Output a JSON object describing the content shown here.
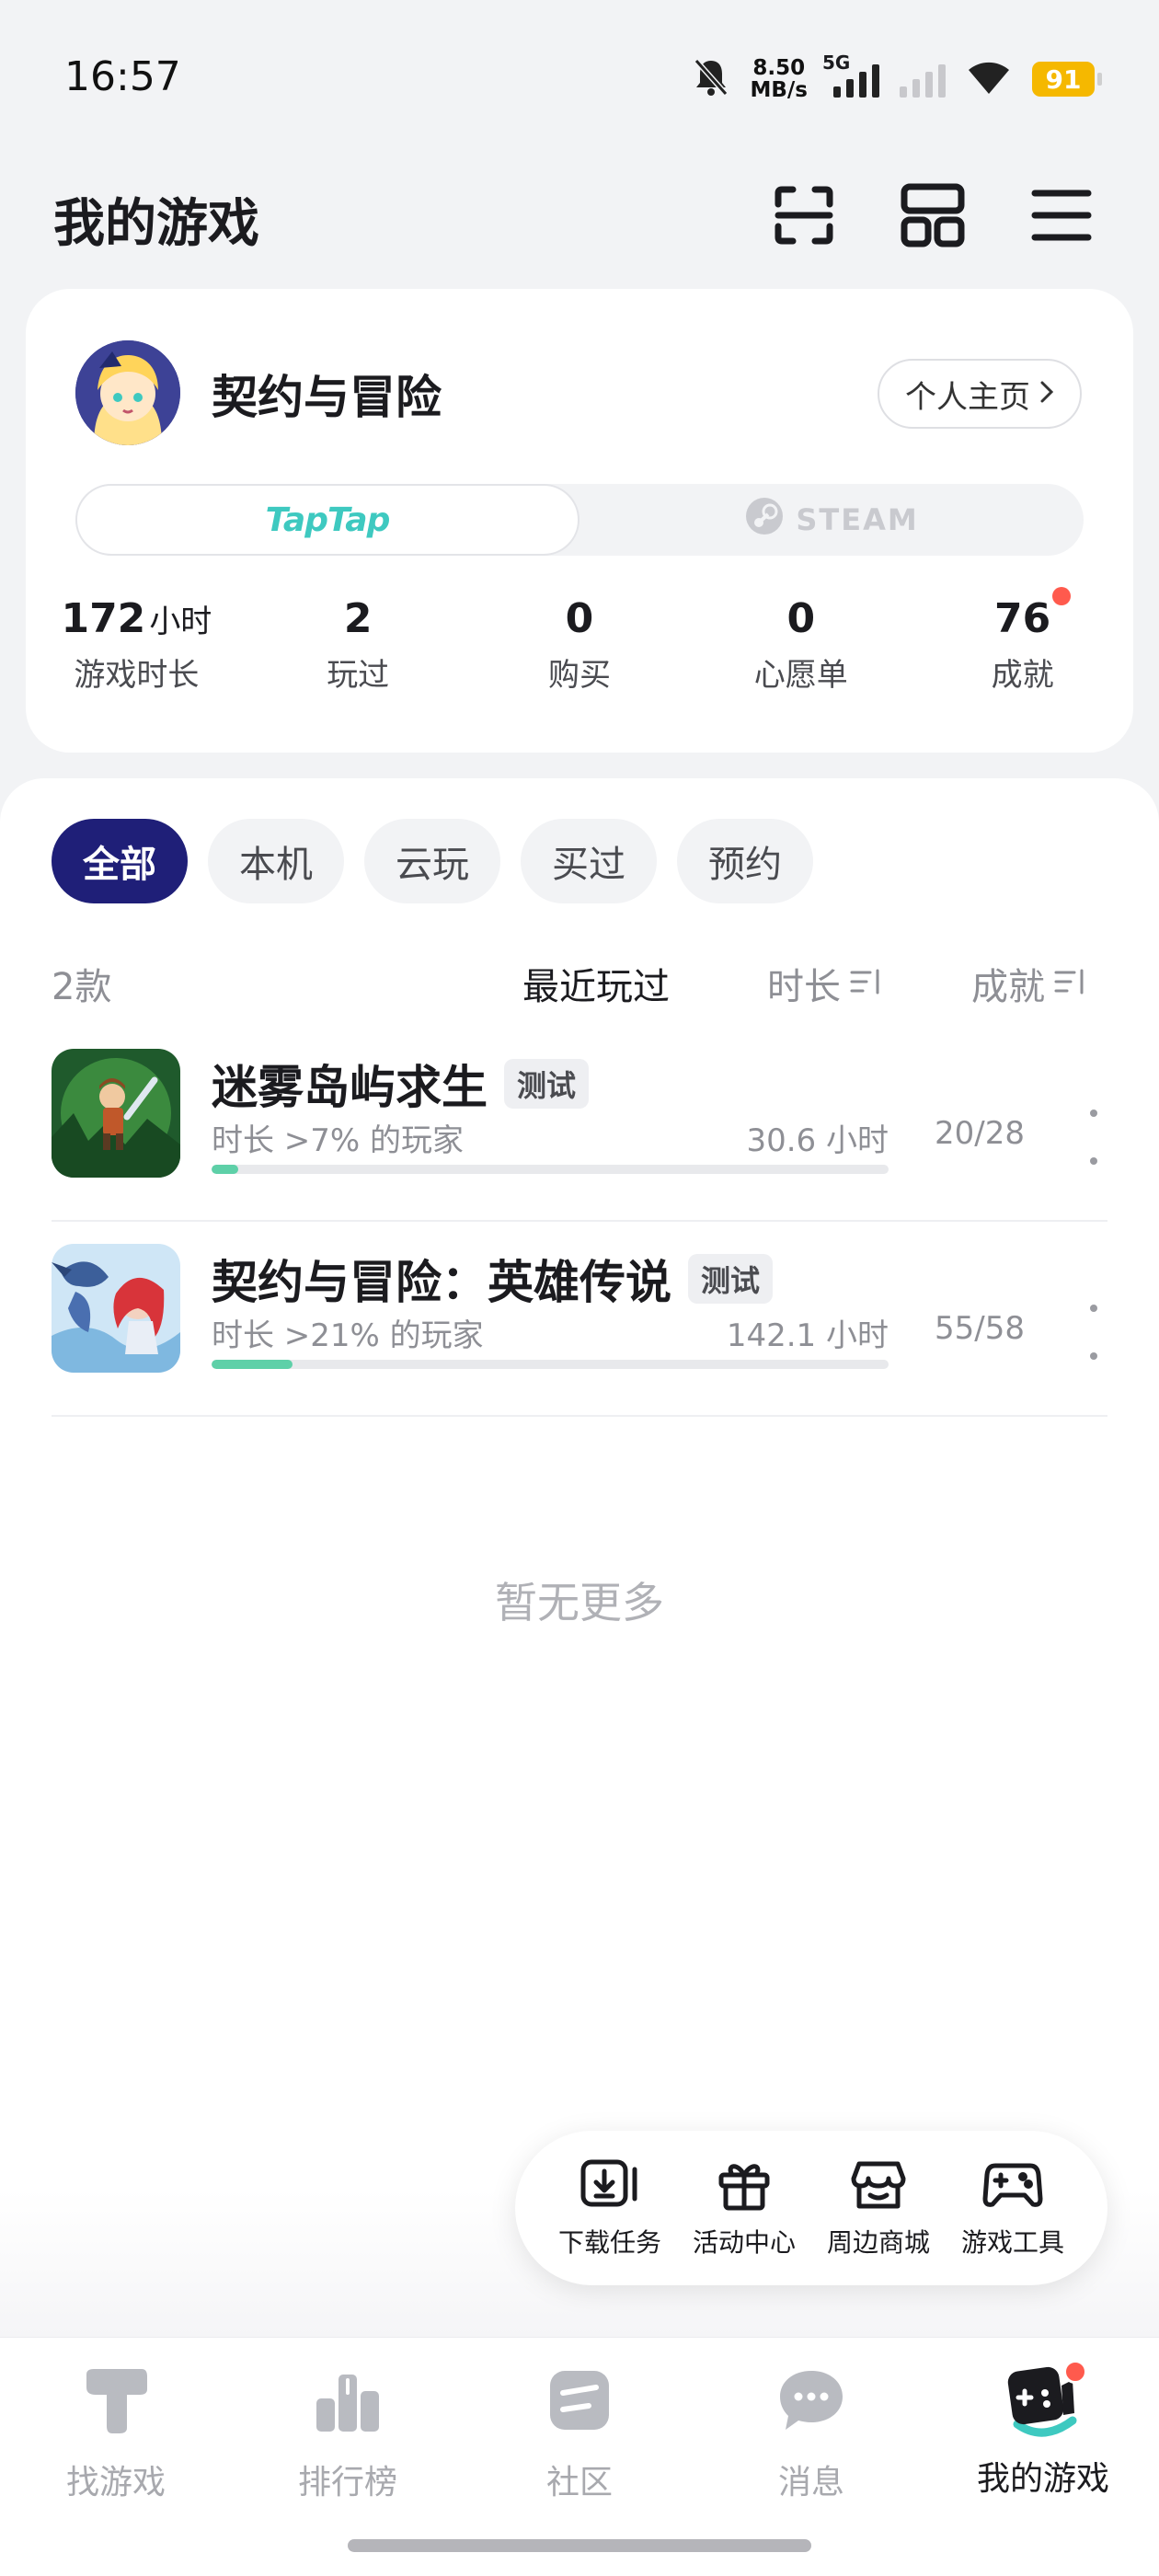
{
  "status_bar": {
    "time": "16:57",
    "net_speed_value": "8.50",
    "net_speed_unit": "MB/s",
    "network_type": "5G",
    "battery": "91",
    "icons": [
      "bell-off-icon",
      "signal-icon",
      "signal-weak-icon",
      "wifi-icon",
      "battery-icon"
    ]
  },
  "header": {
    "title": "我的游戏",
    "icons": [
      "scan-icon",
      "grid-layout-icon",
      "menu-icon"
    ]
  },
  "profile": {
    "name": "契约与冒险",
    "homepage_label": "个人主页",
    "platforms": {
      "active": "TapTap",
      "inactive": "STEAM"
    },
    "stats": {
      "play_time_value": "172",
      "play_time_unit": "小时",
      "play_time_label": "游戏时长",
      "played_value": "2",
      "played_label": "玩过",
      "purchased_value": "0",
      "purchased_label": "购买",
      "wishlist_value": "0",
      "wishlist_label": "心愿单",
      "achievements_value": "76",
      "achievements_label": "成就"
    }
  },
  "filters": {
    "chips": [
      "全部",
      "本机",
      "云玩",
      "买过",
      "预约"
    ],
    "active_index": 0
  },
  "sort": {
    "count": "2款",
    "recent": "最近玩过",
    "duration": "时长",
    "achievement": "成就"
  },
  "games": [
    {
      "name": "迷雾岛屿求生",
      "badge": "测试",
      "percentile": "时长 >7% 的玩家",
      "hours": "30.6 小时",
      "achievements": "20/28",
      "progress": 0.04
    },
    {
      "name": "契约与冒险：英雄传说",
      "badge": "测试",
      "percentile": "时长 >21% 的玩家",
      "hours": "142.1 小时",
      "achievements": "55/58",
      "progress": 0.12
    }
  ],
  "no_more_text": "暂无更多",
  "quick_tools": [
    {
      "label": "下载任务",
      "icon": "download-task-icon"
    },
    {
      "label": "活动中心",
      "icon": "gift-icon"
    },
    {
      "label": "周边商城",
      "icon": "store-icon"
    },
    {
      "label": "游戏工具",
      "icon": "gamepad-icon"
    }
  ],
  "bottom_nav": {
    "items": [
      {
        "label": "找游戏",
        "icon": "taptap-t-icon"
      },
      {
        "label": "排行榜",
        "icon": "ranking-icon"
      },
      {
        "label": "社区",
        "icon": "community-icon"
      },
      {
        "label": "消息",
        "icon": "message-icon"
      },
      {
        "label": "我的游戏",
        "icon": "my-games-icon"
      }
    ],
    "active_index": 4
  },
  "colors": {
    "accent_chip": "#1f1f78",
    "taptap_teal": "#3ec9c0",
    "progress_green": "#5ed0a8",
    "notification_red": "#ff5a4d",
    "battery_yellow": "#f5b800"
  }
}
